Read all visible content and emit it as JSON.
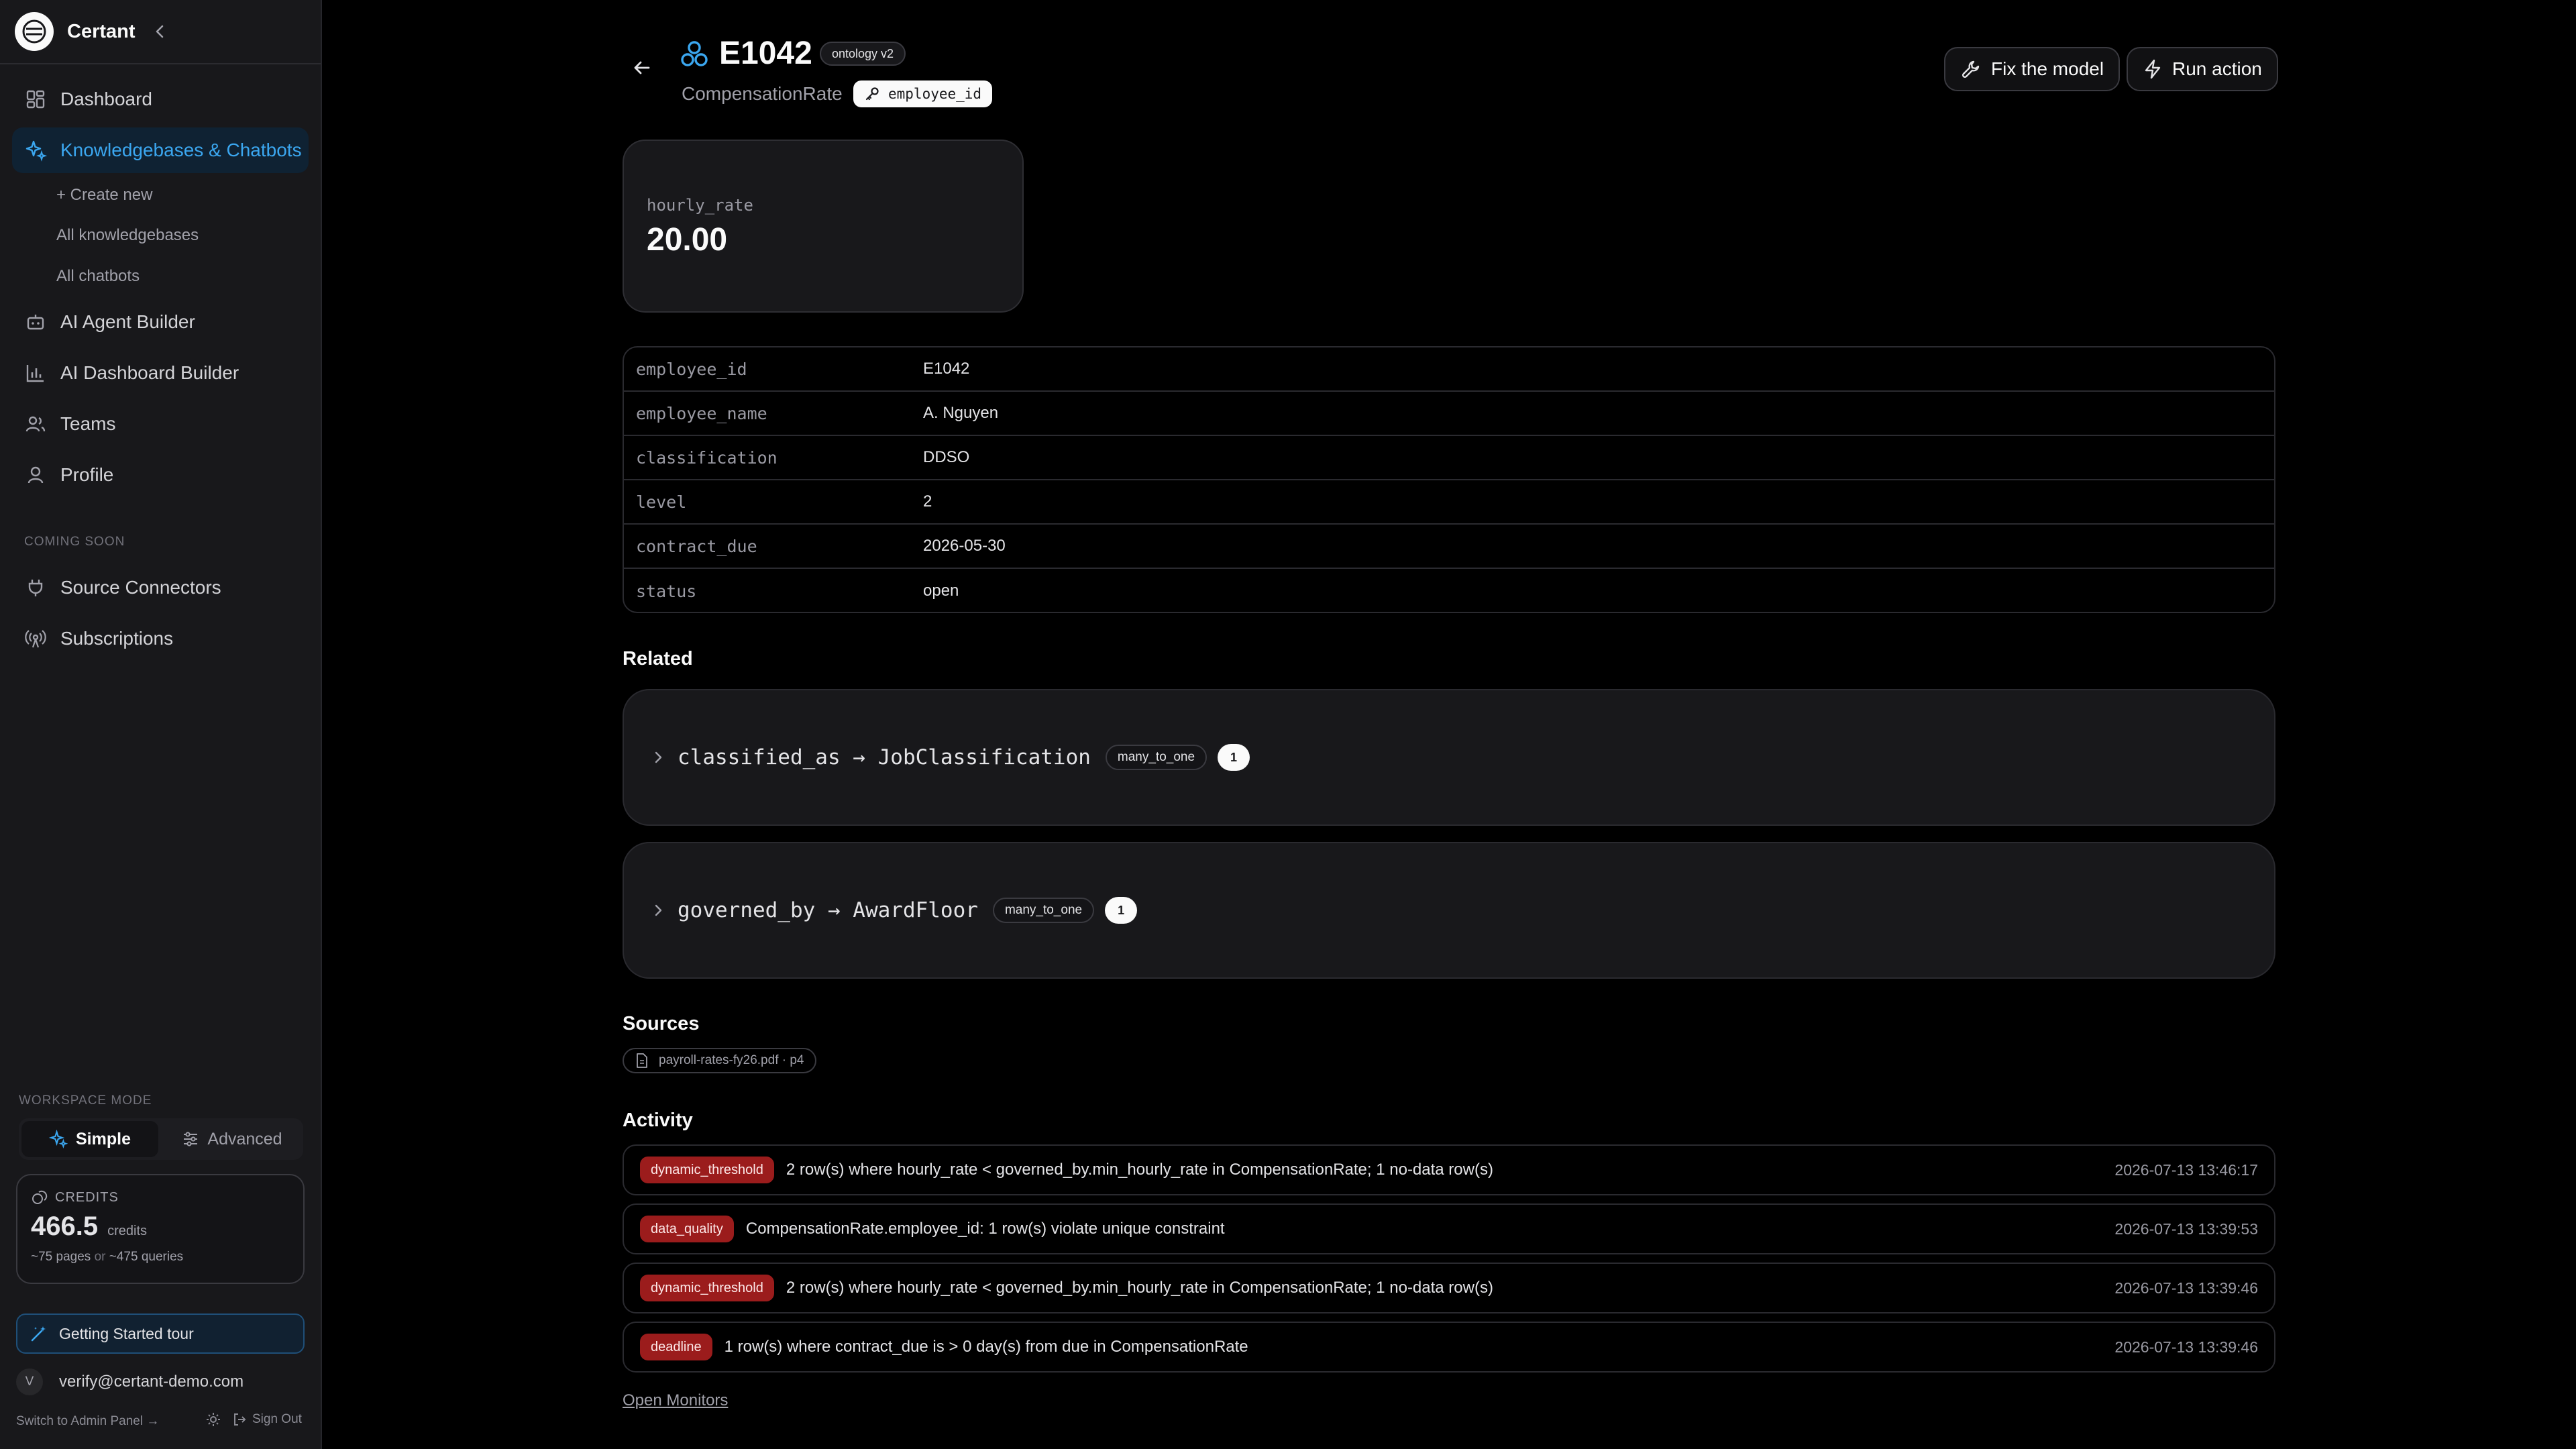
{
  "brand": {
    "name": "Certant"
  },
  "sidebar": {
    "nav": [
      {
        "label": "Dashboard",
        "icon": "dashboard-icon"
      },
      {
        "label": "Knowledgebases & Chatbots",
        "icon": "sparkles-icon",
        "active": true
      },
      {
        "label": "AI Agent Builder",
        "icon": "bot-icon"
      },
      {
        "label": "AI Dashboard Builder",
        "icon": "bar-chart-icon"
      },
      {
        "label": "Teams",
        "icon": "users-icon"
      },
      {
        "label": "Profile",
        "icon": "user-icon"
      }
    ],
    "sub_items": [
      "+ Create new",
      "All knowledgebases",
      "All chatbots"
    ],
    "coming_soon_label": "COMING SOON",
    "coming_soon": [
      {
        "label": "Source Connectors",
        "icon": "plug-icon"
      },
      {
        "label": "Subscriptions",
        "icon": "broadcast-icon"
      }
    ],
    "workspace_mode_label": "WORKSPACE MODE",
    "mode_options": [
      "Simple",
      "Advanced"
    ],
    "mode_selected": "Simple",
    "credits": {
      "label": "CREDITS",
      "value": "466.5",
      "unit": "credits",
      "pages": "~75 pages",
      "or": "or",
      "queries": "~475 queries"
    },
    "tour_label": "Getting Started tour",
    "user": {
      "initial": "V",
      "email": "verify@certant-demo.com"
    },
    "admin_link": "Switch to Admin Panel →",
    "sign_out": "Sign Out"
  },
  "header": {
    "title": "E1042",
    "ontology_badge": "ontology v2",
    "type": "CompensationRate",
    "key_field": "employee_id",
    "buttons": {
      "fix": "Fix the model",
      "run": "Run action"
    }
  },
  "metric": {
    "label": "hourly_rate",
    "value": "20.00"
  },
  "attributes": [
    {
      "key": "employee_id",
      "value": "E1042"
    },
    {
      "key": "employee_name",
      "value": "A. Nguyen"
    },
    {
      "key": "classification",
      "value": "DDSO"
    },
    {
      "key": "level",
      "value": "2"
    },
    {
      "key": "contract_due",
      "value": "2026-05-30"
    },
    {
      "key": "status",
      "value": "open"
    }
  ],
  "related_heading": "Related",
  "related": [
    {
      "label": "classified_as → JobClassification",
      "cardinality": "many_to_one",
      "count": "1"
    },
    {
      "label": "governed_by → AwardFloor",
      "cardinality": "many_to_one",
      "count": "1"
    }
  ],
  "sources_heading": "Sources",
  "sources": [
    "payroll-rates-fy26.pdf · p4"
  ],
  "activity_heading": "Activity",
  "activity": [
    {
      "type": "dynamic_threshold",
      "text": "2 row(s) where hourly_rate < governed_by.min_hourly_rate in CompensationRate; 1 no-data row(s)",
      "time": "2026-07-13 13:46:17"
    },
    {
      "type": "data_quality",
      "text": "CompensationRate.employee_id: 1 row(s) violate unique constraint",
      "time": "2026-07-13 13:39:53"
    },
    {
      "type": "dynamic_threshold",
      "text": "2 row(s) where hourly_rate < governed_by.min_hourly_rate in CompensationRate; 1 no-data row(s)",
      "time": "2026-07-13 13:39:46"
    },
    {
      "type": "deadline",
      "text": "1 row(s) where contract_due is > 0 day(s) from due in CompensationRate",
      "time": "2026-07-13 13:39:46"
    }
  ],
  "open_monitors": "Open Monitors",
  "colors": {
    "accent": "#3ba7f0",
    "badge_red": "#9b1c1c",
    "background": "#000000",
    "sidebar": "#18181b"
  }
}
